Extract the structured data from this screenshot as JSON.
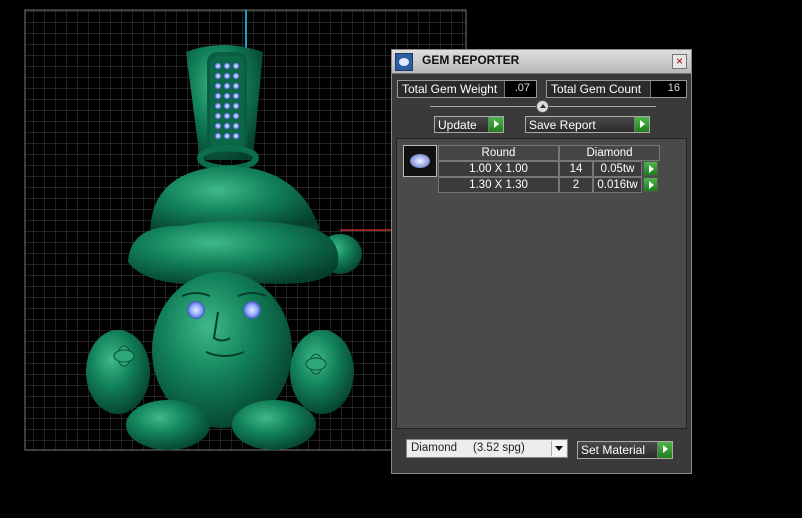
{
  "panel": {
    "title": "GEM REPORTER",
    "close_glyph": "×",
    "total_weight_label": "Total Gem Weight",
    "total_weight_value": ".07",
    "total_count_label": "Total Gem Count",
    "total_count_value": "16",
    "update_label": "Update",
    "save_report_label": "Save Report",
    "material_select_value": "Diamond     (3.52 spg)",
    "set_material_label": "Set Material"
  },
  "table": {
    "header_shape": "Round",
    "header_material": "Diamond",
    "rows": [
      {
        "size": "1.00 X 1.00",
        "count": "14",
        "weight": "0.05tw"
      },
      {
        "size": "1.30 X 1.30",
        "count": "2",
        "weight": "0.016tw"
      }
    ]
  },
  "icons": {
    "app": "gem-reporter-icon",
    "gem": "round-gem-icon",
    "go": "green-arrow-icon"
  },
  "colors": {
    "model_green": "#0f7a55",
    "gem_blue": "#8fa8ff",
    "go_green": "#2e9a2b"
  }
}
